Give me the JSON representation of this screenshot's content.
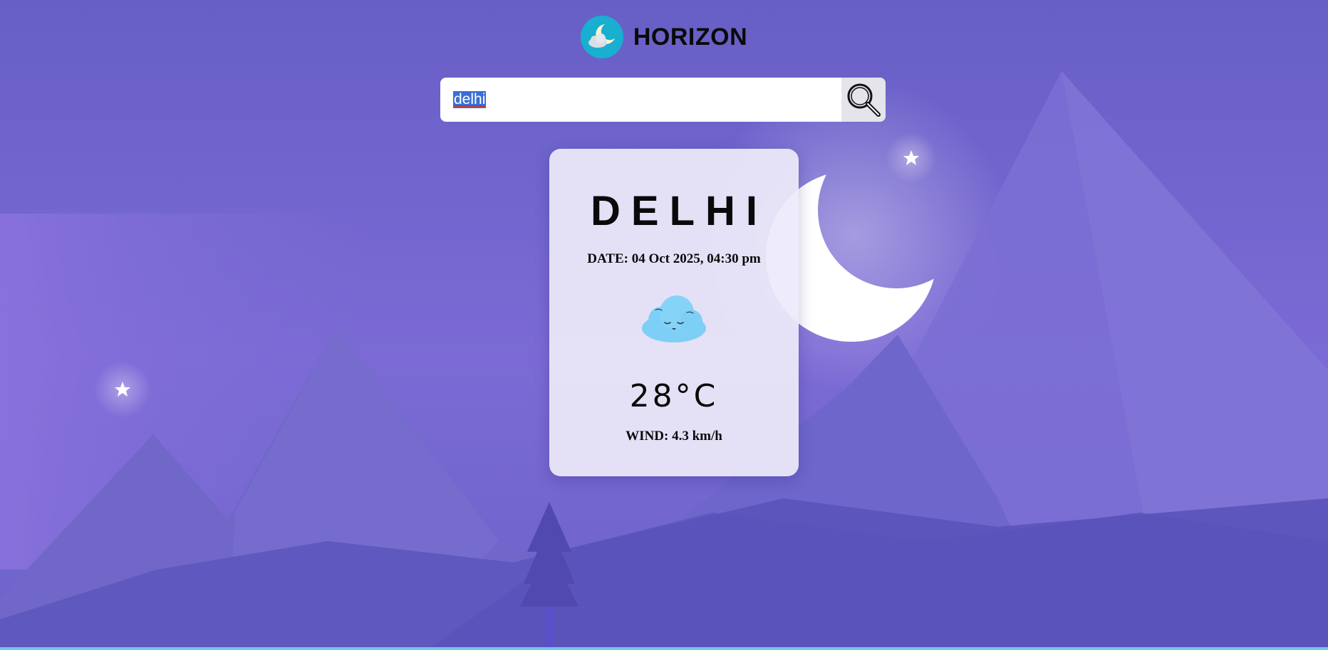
{
  "app": {
    "title": "HORIZON",
    "logo_icon": "moon-cloud-icon"
  },
  "search": {
    "value": "delhi",
    "button_icon": "magnifier-icon"
  },
  "weather_card": {
    "city": "DELHI",
    "date": "DATE: 04 Oct 2025, 04:30 pm",
    "condition_icon": "cloud-icon",
    "temperature": "28°C",
    "wind": "WIND: 4.3 km/h"
  },
  "colors": {
    "background": "#6a62c7",
    "card": "#edebfa",
    "cloud": "#7ecff5",
    "logo_circle": "#1bb6d6",
    "moon": "#ffffff",
    "bottom_strip": "#6fc9e6"
  }
}
